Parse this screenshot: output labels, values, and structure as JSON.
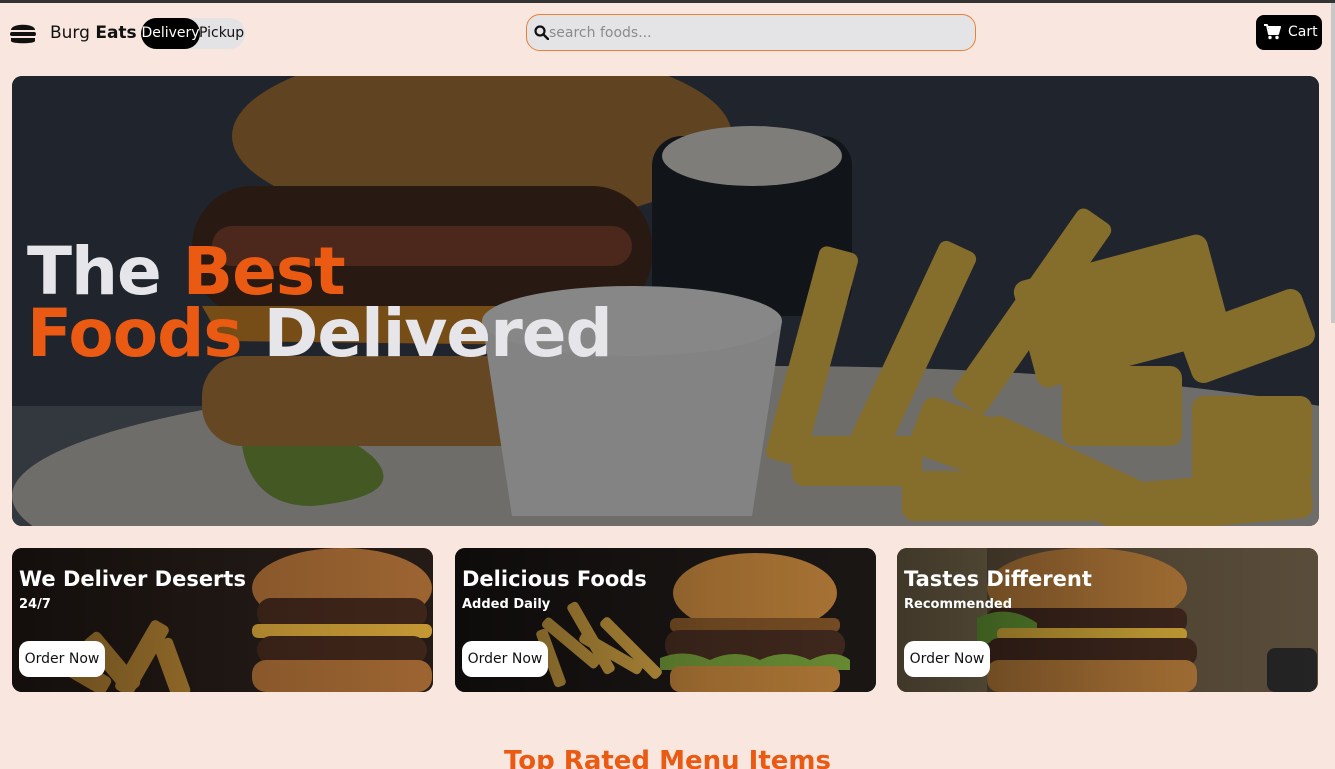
{
  "header": {
    "logo_icon": "burger-icon",
    "brand_regular": "Burg",
    "brand_bold": "Eats",
    "toggle": {
      "options": [
        "Delivery",
        "Pickup"
      ],
      "selected": "Delivery"
    },
    "search": {
      "placeholder": "search foods...",
      "value": "",
      "icon": "search-icon"
    },
    "cart": {
      "label": "Cart",
      "icon": "cart-icon"
    }
  },
  "hero": {
    "title_line1_a": "The",
    "title_line1_b": "Best",
    "title_line2_a": "Foods",
    "title_line2_b": "Delivered",
    "accent_color": "#ea5a12"
  },
  "cards": [
    {
      "title": "We Deliver Deserts",
      "subtitle": "24/7",
      "button": "Order Now"
    },
    {
      "title": "Delicious Foods",
      "subtitle": "Added Daily",
      "button": "Order Now"
    },
    {
      "title": "Tastes Different",
      "subtitle": "Recommended",
      "button": "Order Now"
    }
  ],
  "section": {
    "title": "Top Rated Menu Items"
  }
}
